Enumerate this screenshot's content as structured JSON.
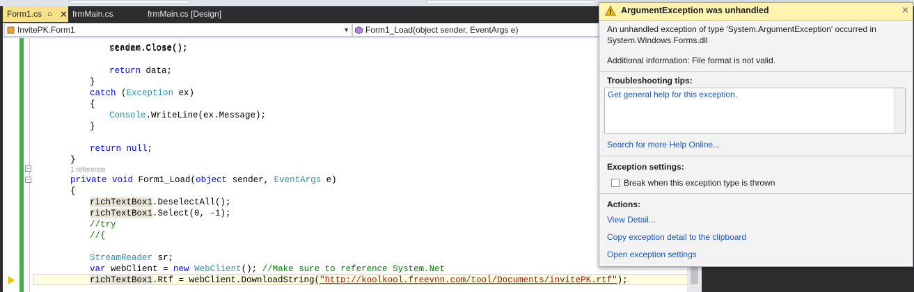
{
  "tabs": [
    {
      "label": "Form1.cs",
      "pin": "⌂",
      "close": "✕"
    },
    {
      "label": "frmMain.cs"
    },
    {
      "label": "frmMain.cs [Design]"
    }
  ],
  "nav": {
    "class_dropdown": "InvitePK.Form1",
    "member_dropdown": "Form1_Load(object sender, EventArgs e)"
  },
  "code": {
    "l_reader_close": "reader.Close();",
    "l_stream_close": "stream.Close();",
    "kw_return": "return",
    "t_data": " data;",
    "brace_close": "}",
    "brace_open": "{",
    "kw_catch": "catch",
    "paren_open": " (",
    "ty_exception": "Exception",
    "t_ex": " ex)",
    "ty_console": "Console",
    "t_writeline": ".WriteLine(ex.Message);",
    "kw_null": "null",
    "t_semicolon": ";",
    "ref_count": "1 reference",
    "kw_private": "private",
    "kw_void": "void",
    "t_form1_load": " Form1_Load(",
    "kw_object": "object",
    "t_sender": " sender, ",
    "ty_eventargs": "EventArgs",
    "t_e": " e)",
    "hl_rtb": "richTextBox1",
    "t_deselect": ".DeselectAll();",
    "t_select": ".Select(0, -1);",
    "cm_try": "//try",
    "cm_brace": "//{",
    "ty_streamreader": "StreamReader",
    "t_sr": " sr;",
    "kw_var": "var",
    "t_webclient_eq": " webClient = ",
    "kw_new": "new",
    "ty_webclient": "WebClient",
    "t_call": "(); ",
    "cm_ref": "//Make sure to reference System.Net",
    "t_rtf": ".Rtf = webClient.DownloadString(",
    "str_url": "\"http://koolkool.freevnn.com/tool/Documents/invitePK.rtf\"",
    "t_end": ");"
  },
  "exception": {
    "title": "ArgumentException was unhandled",
    "close": "✕",
    "message_line1": "An unhandled exception of type 'System.ArgumentException' occurred in",
    "message_line2": "System.Windows.Forms.dll",
    "additional_info": "Additional information: File format is not valid.",
    "tips_heading": "Troubleshooting tips:",
    "tip_link": "Get general help for this exception.",
    "search_link": "Search for more Help Online...",
    "settings_heading": "Exception settings:",
    "break_checkbox_label": "Break when this exception type is thrown",
    "break_checked": false,
    "actions_heading": "Actions:",
    "action_view_detail": "View Detail...",
    "action_copy": "Copy exception detail to the clipboard",
    "action_open_settings": "Open exception settings"
  },
  "colors": {
    "keyword": "#0000ff",
    "type": "#2b91af",
    "comment": "#008000",
    "string": "#a31515",
    "active_tab": "#f5e28a",
    "popup_header": "#fff3b0",
    "change_bar": "#3eb049",
    "link": "#1a56b8"
  },
  "icons": {
    "warning": "warning-icon",
    "pin": "pin-icon",
    "close": "close-icon",
    "class": "class-icon",
    "method": "method-icon",
    "instruction_pointer": "instruction-pointer-icon"
  }
}
